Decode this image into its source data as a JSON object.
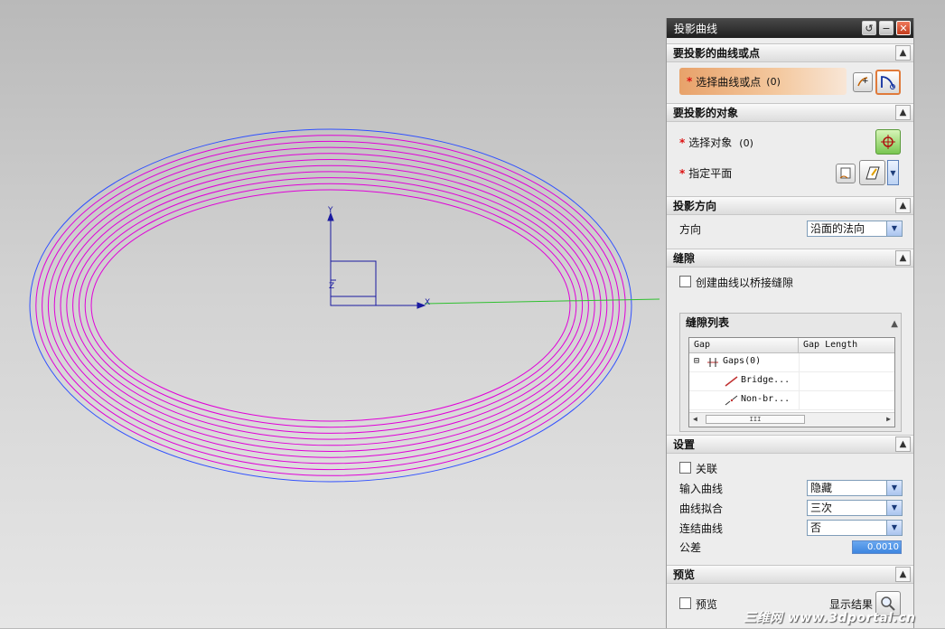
{
  "viewport": {
    "axis_labels": {
      "x": "X",
      "y": "Y",
      "z": "Z"
    },
    "colors": {
      "curves": "#e000d8",
      "outer_curve": "#3050ff",
      "x_axis_line": "#30c030",
      "triad": "#1a1aa0"
    }
  },
  "dialog": {
    "title": "投影曲线",
    "title_buttons": {
      "reset": "↺",
      "minimize": "−",
      "close": "✕"
    },
    "sections": {
      "curves": {
        "header": "要投影的曲线或点",
        "select_label": "选择曲线或点",
        "select_count": "(0)"
      },
      "objects": {
        "header": "要投影的对象",
        "select_label": "选择对象",
        "select_count": "(0)",
        "plane_label": "指定平面"
      },
      "direction": {
        "header": "投影方向",
        "label": "方向",
        "value": "沿面的法向"
      },
      "gaps": {
        "header": "缝隙",
        "checkbox_label": "创建曲线以桥接缝隙",
        "list_header": "缝隙列表",
        "columns": [
          "Gap",
          "Gap Length"
        ],
        "rows": [
          {
            "label": "Gaps(0)",
            "expander": "⊟"
          },
          {
            "label": "Bridge..."
          },
          {
            "label": "Non-br..."
          }
        ],
        "scroll_thumb": "III"
      },
      "settings": {
        "header": "设置",
        "associate_label": "关联",
        "input_curve_label": "输入曲线",
        "input_curve_value": "隐藏",
        "curve_fit_label": "曲线拟合",
        "curve_fit_value": "三次",
        "join_label": "连结曲线",
        "join_value": "否",
        "tolerance_label": "公差",
        "tolerance_value": "0.0010"
      },
      "preview": {
        "header": "预览",
        "preview_label": "预览",
        "show_result_label": "显示结果"
      }
    }
  },
  "watermark": "三维网 www.3dportal.cn"
}
